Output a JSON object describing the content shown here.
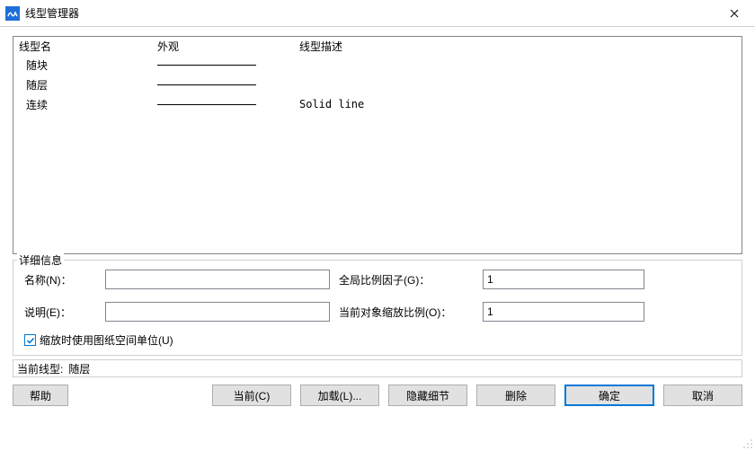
{
  "window": {
    "title": "线型管理器"
  },
  "list": {
    "headers": {
      "name": "线型名",
      "appearance": "外观",
      "description": "线型描述"
    },
    "rows": [
      {
        "name": "随块",
        "description": ""
      },
      {
        "name": "随层",
        "description": ""
      },
      {
        "name": "连续",
        "description": "Solid line"
      }
    ]
  },
  "details": {
    "legend": "详细信息",
    "name_label": "名称(N)：",
    "name_value": "",
    "desc_label": "说明(E)：",
    "desc_value": "",
    "global_label": "全局比例因子(G)：",
    "global_value": "1",
    "current_label": "当前对象缩放比例(O)：",
    "current_value": "1",
    "checkbox_label": "缩放时使用图纸空间单位(U)",
    "checkbox_checked": true
  },
  "status": {
    "label": "当前线型:",
    "value": "随层"
  },
  "buttons": {
    "help": "帮助",
    "current": "当前(C)",
    "load": "加载(L)...",
    "hide": "隐藏细节",
    "delete": "删除",
    "ok": "确定",
    "cancel": "取消"
  }
}
